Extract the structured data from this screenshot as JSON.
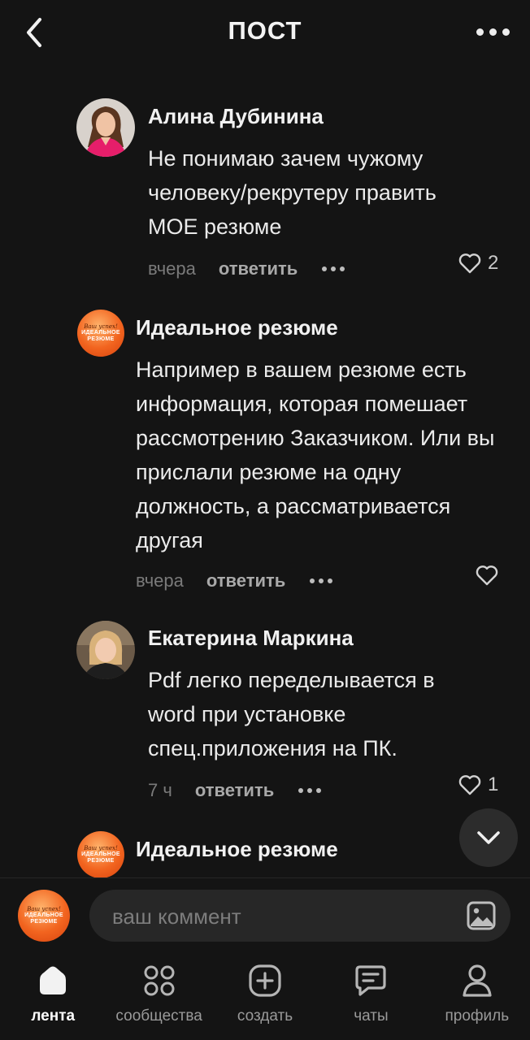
{
  "header": {
    "title": "ПОСТ"
  },
  "comments": [
    {
      "author": "Алина Дубинина",
      "text": "Не понимаю зачем чужому человеку/рекрутеру править МОЕ резюме",
      "time": "вчера",
      "reply": "ответить",
      "likes": "2"
    },
    {
      "author": "Идеальное резюме",
      "text": "Например в вашем резюме есть информация, которая помешает рассмотрению Заказчиком. Или вы прислали резюме на одну должность, а рассматривается другая",
      "time": "вчера",
      "reply": "ответить",
      "likes": ""
    },
    {
      "author": "Екатерина Маркина",
      "text": "Pdf легко  переделывается в word при установке спец.приложения на ПК.",
      "time": "7 ч",
      "reply": "ответить",
      "likes": "1"
    },
    {
      "author": "Идеальное резюме"
    }
  ],
  "brand_avatar": {
    "script": "Ваш успех!",
    "line1": "ИДЕАЛЬНОЕ",
    "line2": "РЕЗЮМЕ"
  },
  "composer": {
    "placeholder": "ваш коммент"
  },
  "nav": [
    {
      "label": "лента",
      "icon": "home-icon",
      "active": true
    },
    {
      "label": "сообщества",
      "icon": "grid-icon"
    },
    {
      "label": "создать",
      "icon": "plus-icon"
    },
    {
      "label": "чаты",
      "icon": "chat-icon"
    },
    {
      "label": "профиль",
      "icon": "profile-icon"
    }
  ],
  "colors": {
    "background": "#141414",
    "text": "#ececec",
    "muted": "#7a7a7a",
    "brand": "#f2641f"
  }
}
